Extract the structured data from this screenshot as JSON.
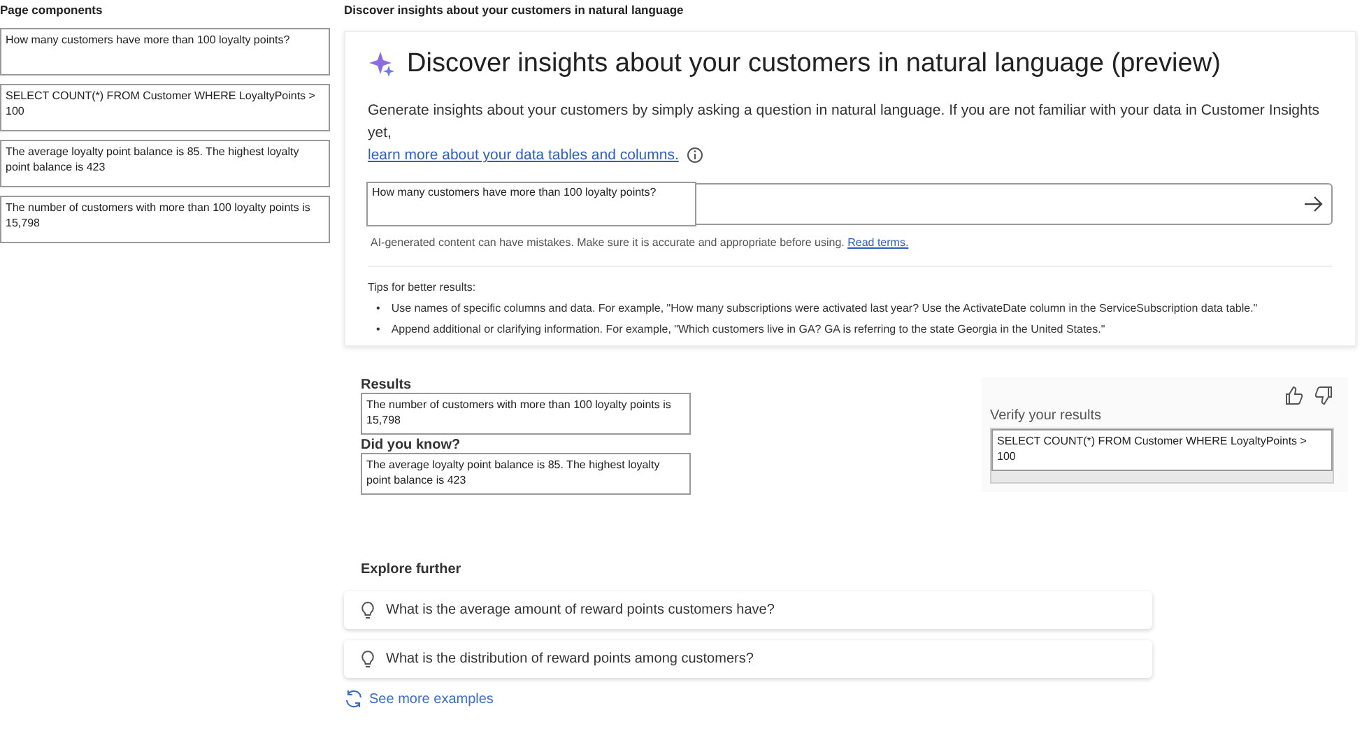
{
  "left_panel": {
    "title": "Page components",
    "items": [
      "How many customers have more than 100 loyalty points?",
      "SELECT COUNT(*) FROM Customer WHERE LoyaltyPoints > 100",
      "The average loyalty point balance is 85. The highest loyalty point balance is 423",
      "The number of customers with more than 100 loyalty points is 15,798"
    ]
  },
  "header": "Discover insights about your customers in natural language",
  "card": {
    "title": "Discover insights about your customers in natural language (preview)",
    "description": "Generate insights about your customers by simply asking a question in natural language. If you are not familiar with your data in Customer Insights yet,",
    "link": "learn more about your data tables and columns.",
    "query": {
      "value": "How many customers have more than 100 loyalty points?"
    },
    "disclaimer": "AI-generated content can have mistakes. Make sure it is accurate and appropriate before using.",
    "terms_link": "Read terms.",
    "tips_title": "Tips for better results:",
    "tip_marker": "•",
    "tips": [
      "Use names of specific columns and data. For example, \"How many subscriptions were activated last year? Use the ActivateDate column in the ServiceSubscription data table.\"",
      "Append additional or clarifying information. For example, \"Which customers live in GA? GA is referring to the state Georgia in the United States.\""
    ]
  },
  "results": {
    "label": "Results",
    "value": "The number of customers with more than 100 loyalty points is 15,798",
    "did_you_know_label": "Did you know?",
    "did_you_know": "The average loyalty point balance is 85. The highest loyalty point balance is 423"
  },
  "verify": {
    "label": "Verify your results",
    "value": "SELECT COUNT(*) FROM Customer WHERE LoyaltyPoints > 100"
  },
  "explore": {
    "title": "Explore further",
    "suggestions": [
      "What is the average amount of reward points customers have?",
      "What is the distribution of reward points among customers?"
    ],
    "more_link": "See more examples"
  }
}
